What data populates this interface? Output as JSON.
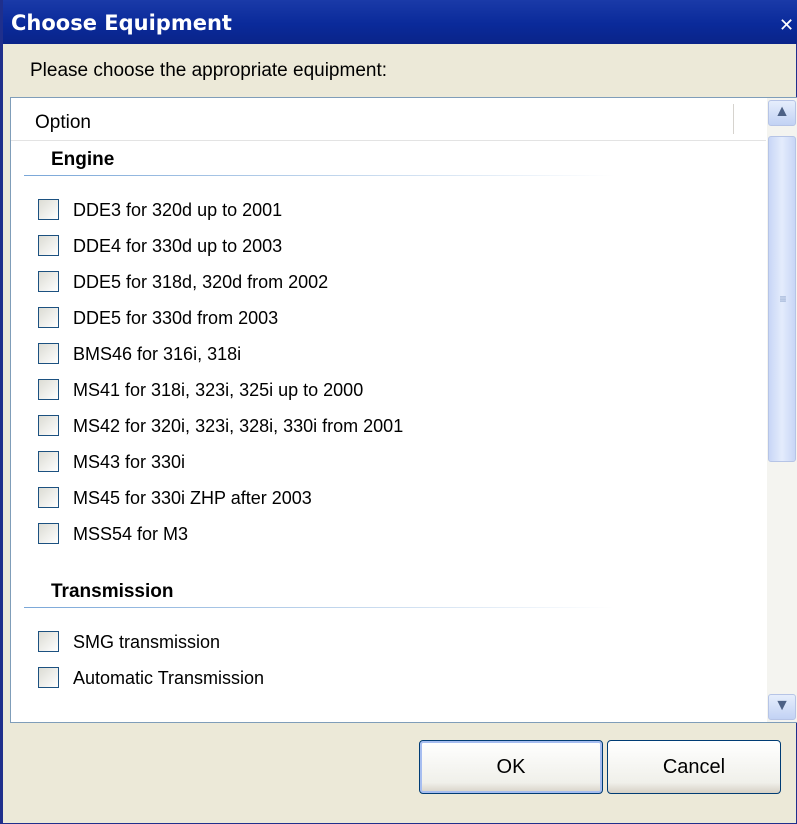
{
  "window": {
    "title": "Choose Equipment",
    "close_glyph": "✕"
  },
  "prompt": "Please choose the appropriate equipment:",
  "list": {
    "column_header": "Option",
    "groups": [
      {
        "title": "Engine",
        "items": [
          {
            "label": "DDE3 for 320d up to 2001",
            "checked": false
          },
          {
            "label": "DDE4 for 330d up to 2003",
            "checked": false
          },
          {
            "label": "DDE5 for 318d, 320d from 2002",
            "checked": false
          },
          {
            "label": "DDE5 for 330d from 2003",
            "checked": false
          },
          {
            "label": "BMS46 for 316i, 318i",
            "checked": false
          },
          {
            "label": "MS41 for 318i, 323i, 325i up to 2000",
            "checked": false
          },
          {
            "label": "MS42 for 320i, 323i, 328i, 330i from 2001",
            "checked": false
          },
          {
            "label": "MS43 for 330i",
            "checked": false
          },
          {
            "label": "MS45 for 330i ZHP after 2003",
            "checked": false
          },
          {
            "label": "MSS54 for M3",
            "checked": false
          }
        ]
      },
      {
        "title": "Transmission",
        "items": [
          {
            "label": "SMG transmission",
            "checked": false
          },
          {
            "label": "Automatic Transmission",
            "checked": false
          }
        ]
      }
    ]
  },
  "buttons": {
    "ok": "OK",
    "cancel": "Cancel"
  },
  "scroll": {
    "position": 0.0
  },
  "icons": {
    "close": "close-icon",
    "scroll_up": "chevron-up-icon",
    "scroll_down": "chevron-down-icon",
    "scroll_grip": "grip-icon"
  },
  "colors": {
    "titlebar": "#0a2a9a",
    "window_bg": "#ece9d8",
    "accent_line": "#7aa7d8"
  }
}
